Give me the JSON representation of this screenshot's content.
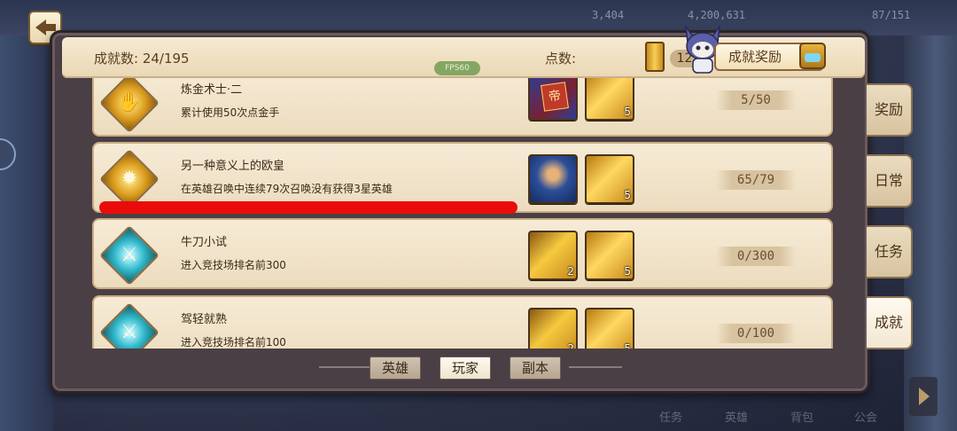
{
  "background": {
    "top_texts": [
      "3,404",
      "4,200,631",
      "87/151"
    ],
    "bottom_texts": [
      "任务",
      "英雄",
      "背包",
      "公会"
    ]
  },
  "header": {
    "achievements_label": "成就数: 24/195",
    "points_label": "点数:",
    "points_value": "125",
    "fps_tag": "FPS60",
    "reward_button": "成就奖励"
  },
  "achievements": [
    {
      "title": "炼金术士·二",
      "description": "累计使用50次点金手",
      "icon": "gold-hand-icon",
      "rewards": [
        {
          "type": "red-card",
          "count": ""
        },
        {
          "type": "gold-book",
          "count": "5"
        }
      ],
      "progress": "5/50"
    },
    {
      "title": "另一种意义上的欧皇",
      "description": "在英雄召唤中连续79次召唤没有获得3星英雄",
      "icon": "star-burst-icon",
      "rewards": [
        {
          "type": "hero-portrait",
          "count": ""
        },
        {
          "type": "gold-book",
          "count": "5"
        }
      ],
      "progress": "65/79"
    },
    {
      "title": "牛刀小试",
      "description": "进入竞技场排名前300",
      "icon": "sword-icon",
      "rewards": [
        {
          "type": "gold-card",
          "count": "2"
        },
        {
          "type": "gold-book",
          "count": "5"
        }
      ],
      "progress": "0/300"
    },
    {
      "title": "驾轻就熟",
      "description": "进入竞技场排名前100",
      "icon": "sword-icon",
      "rewards": [
        {
          "type": "gold-card",
          "count": "2"
        },
        {
          "type": "gold-book",
          "count": "5"
        }
      ],
      "progress": "0/100"
    }
  ],
  "side_tabs": [
    {
      "label": "奖励",
      "active": false
    },
    {
      "label": "日常",
      "active": false
    },
    {
      "label": "任务",
      "active": false
    },
    {
      "label": "成就",
      "active": true
    }
  ],
  "bottom_tabs": [
    {
      "label": "英雄",
      "active": false
    },
    {
      "label": "玩家",
      "active": true
    },
    {
      "label": "副本",
      "active": false
    }
  ]
}
